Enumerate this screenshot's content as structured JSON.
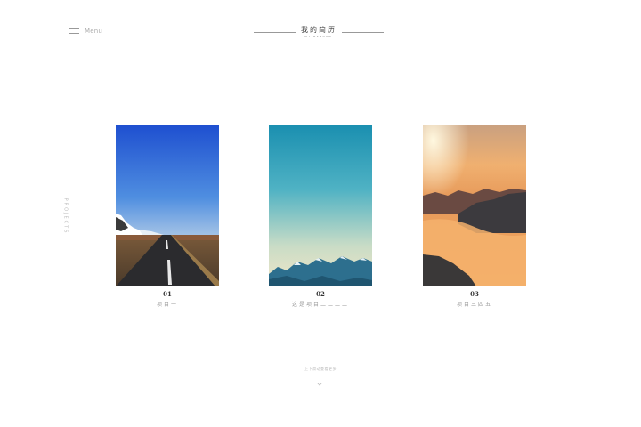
{
  "menu": {
    "label": "Menu",
    "icon": "hamburger-icon"
  },
  "header": {
    "title": "我的简历",
    "subtitle": "MY RESUME"
  },
  "side_label": "PROJECTS",
  "projects": [
    {
      "number": "01",
      "name": "项目一",
      "image": "road-mountain-photo"
    },
    {
      "number": "02",
      "name": "这是项目二二二二",
      "image": "sky-mountain-photo"
    },
    {
      "number": "03",
      "name": "项目三四五",
      "image": "sunset-clouds-photo"
    }
  ],
  "scroll_hint": "上下滑动查看更多",
  "chevron_icon": "chevron-down-icon"
}
